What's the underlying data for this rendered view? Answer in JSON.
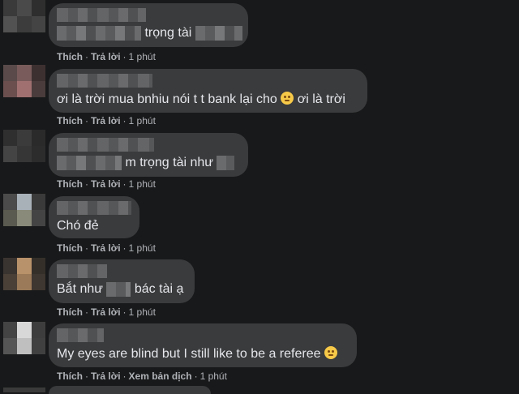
{
  "comments": [
    {
      "pre": "",
      "post": "trọng tài",
      "time": "1 phút"
    },
    {
      "pre": "",
      "post": "ơi là trời mua bnhiu nói t t bank lại cho",
      "after_emoji": "ơi là trời",
      "time": "1 phút"
    },
    {
      "pre": "",
      "post": "m trọng tài như",
      "time": "1 phút"
    },
    {
      "pre": "",
      "post": "Chó đẻ",
      "time": "1 phút"
    },
    {
      "pre": "Bắt như",
      "post": "bác tài ạ",
      "time": "1 phút"
    },
    {
      "pre": "",
      "post": "My eyes are blind but I still like to be a referee",
      "time": "1 phút",
      "translate": "Xem bản dịch"
    }
  ],
  "actions": {
    "like": "Thích",
    "reply": "Trả lời",
    "dot": "·"
  },
  "icons": {
    "emoji": "face-emoji-icon"
  }
}
